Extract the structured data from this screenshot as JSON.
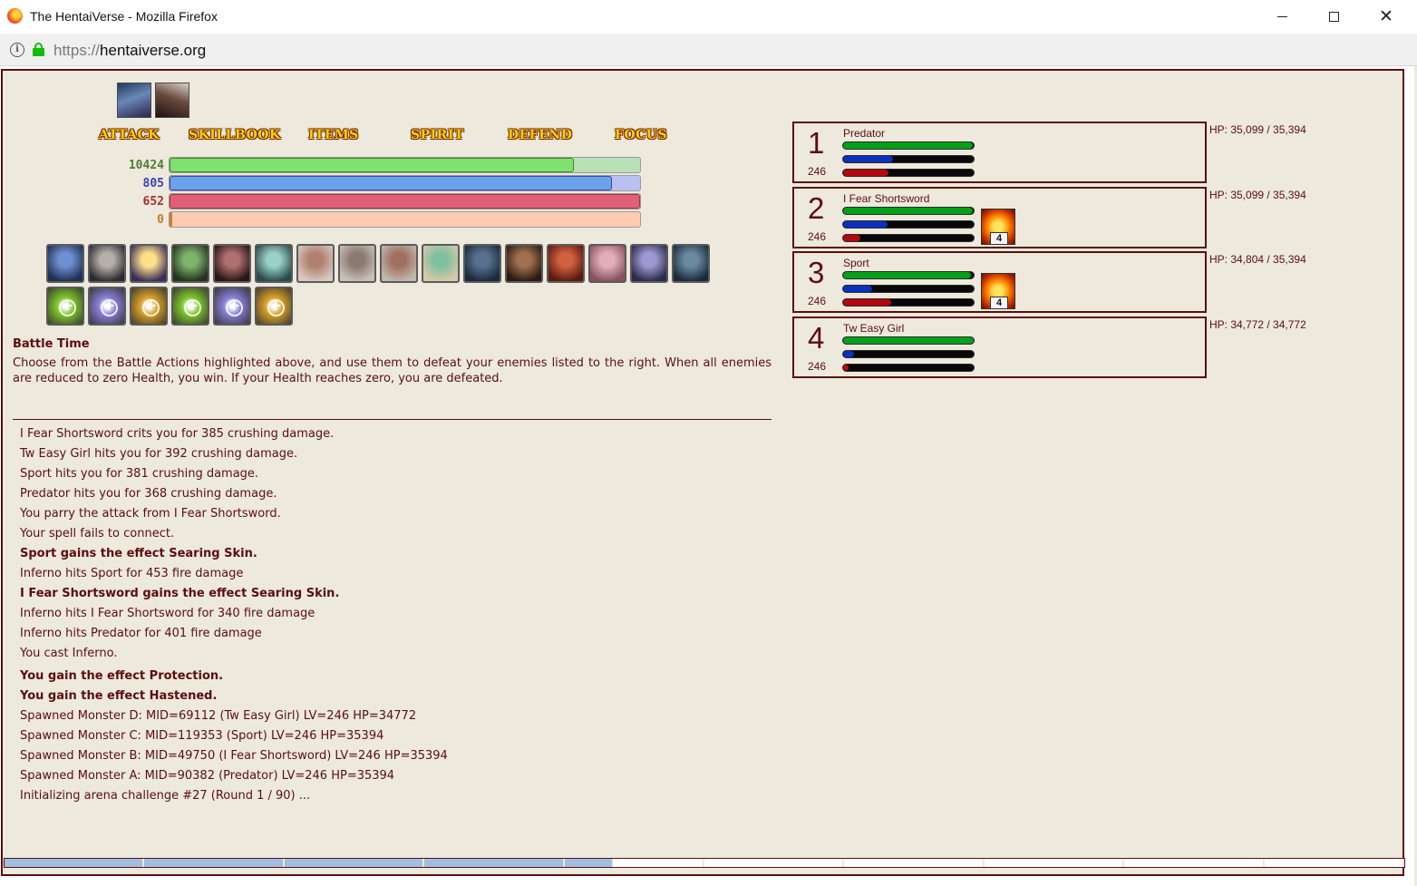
{
  "window": {
    "title": "The HentaiVerse - Mozilla Firefox",
    "url_scheme": "https://",
    "url_host": "hentaiverse.org",
    "controls": {
      "minimize": "minimize-icon",
      "maximize": "maximize-icon",
      "close": "close-icon"
    },
    "close_glyph": "✕"
  },
  "player": {
    "effects": [
      "protection-effect-icon",
      "hastened-effect-icon"
    ]
  },
  "commands": [
    {
      "label": "ATTACK"
    },
    {
      "label": "SKILLBOOK"
    },
    {
      "label": "ITEMS"
    },
    {
      "label": "SPIRIT"
    },
    {
      "label": "DEFEND"
    },
    {
      "label": "FOCUS"
    }
  ],
  "vitals": [
    {
      "name": "health",
      "value": "10424",
      "fill": 0.86,
      "color": "#4f7f2b",
      "bar": "#7fe16f",
      "track": "#b8dfb5"
    },
    {
      "name": "magic",
      "value": "805",
      "fill": 0.94,
      "color": "#3b3fb6",
      "bar": "#6ba3ea",
      "track": "#b9c1f3"
    },
    {
      "name": "spirit",
      "value": "652",
      "fill": 1.0,
      "color": "#a73030",
      "bar": "#e0607a",
      "track": "#f3b8c0"
    },
    {
      "name": "overcharge",
      "value": "0",
      "fill": 0.005,
      "color": "#c97a2a",
      "bar": "#e07b29",
      "track": "#ffcbb3"
    }
  ],
  "skills": [
    {
      "name": "skill-1"
    },
    {
      "name": "skill-2"
    },
    {
      "name": "skill-3"
    },
    {
      "name": "skill-4"
    },
    {
      "name": "skill-5"
    },
    {
      "name": "skill-6"
    },
    {
      "name": "skill-7"
    },
    {
      "name": "skill-8"
    },
    {
      "name": "skill-9"
    },
    {
      "name": "skill-10"
    },
    {
      "name": "skill-11"
    },
    {
      "name": "skill-12"
    },
    {
      "name": "skill-13"
    },
    {
      "name": "skill-14"
    },
    {
      "name": "skill-15"
    },
    {
      "name": "skill-16"
    }
  ],
  "spells": [
    {
      "color": "#7fc62e"
    },
    {
      "color": "#8a7fd6"
    },
    {
      "color": "#d8a12a"
    },
    {
      "color": "#7fc62e"
    },
    {
      "color": "#8a7fd6"
    },
    {
      "color": "#d8a12a"
    }
  ],
  "info": {
    "title": "Battle Time",
    "text": "Choose from the Battle Actions highlighted above, and use them to defeat your enemies listed to the right. When all enemies are reduced to zero Health, you win. If your Health reaches zero, you are defeated."
  },
  "log": [
    {
      "text": "I Fear Shortsword crits you for 385 crushing damage.",
      "bold": false
    },
    {
      "text": "Tw Easy Girl hits you for 392 crushing damage.",
      "bold": false
    },
    {
      "text": "Sport hits you for 381 crushing damage.",
      "bold": false
    },
    {
      "text": "Predator hits you for 368 crushing damage.",
      "bold": false
    },
    {
      "text": "You parry the attack from I Fear Shortsword.",
      "bold": false
    },
    {
      "text": "Your spell fails to connect.",
      "bold": false
    },
    {
      "text": "Sport gains the effect Searing Skin.",
      "bold": true
    },
    {
      "text": "Inferno hits Sport for 453 fire damage",
      "bold": false
    },
    {
      "text": "I Fear Shortsword gains the effect Searing Skin.",
      "bold": true
    },
    {
      "text": "Inferno hits I Fear Shortsword for 340 fire damage",
      "bold": false
    },
    {
      "text": "Inferno hits Predator for 401 fire damage",
      "bold": false
    },
    {
      "text": "You cast Inferno.",
      "bold": false
    },
    {
      "text": "You gain the effect Protection.",
      "bold": true
    },
    {
      "text": "You gain the effect Hastened.",
      "bold": true
    },
    {
      "text": "Spawned Monster D: MID=69112 (Tw Easy Girl) LV=246 HP=34772",
      "bold": false
    },
    {
      "text": "Spawned Monster C: MID=119353 (Sport) LV=246 HP=35394",
      "bold": false
    },
    {
      "text": "Spawned Monster B: MID=49750 (I Fear Shortsword) LV=246 HP=35394",
      "bold": false
    },
    {
      "text": "Spawned Monster A: MID=90382 (Predator) LV=246 HP=35394",
      "bold": false
    },
    {
      "text": "Initializing arena challenge #27 (Round 1 / 90) ...",
      "bold": false
    }
  ],
  "monsters": [
    {
      "num": "1",
      "lv": "246",
      "name": "Predator",
      "hp": 0.99,
      "mp": 0.38,
      "sp": 0.35,
      "hp_text": "HP: 35,099 / 35,394",
      "effect": null
    },
    {
      "num": "2",
      "lv": "246",
      "name": "I Fear Shortsword",
      "hp": 0.99,
      "mp": 0.34,
      "sp": 0.13,
      "hp_text": "HP: 35,099 / 35,394",
      "effect": {
        "icon": "searing-skin-effect-icon",
        "count": "4"
      }
    },
    {
      "num": "3",
      "lv": "246",
      "name": "Sport",
      "hp": 0.98,
      "mp": 0.22,
      "sp": 0.37,
      "hp_text": "HP: 34,804 / 35,394",
      "effect": {
        "icon": "searing-skin-effect-icon",
        "count": "4"
      }
    },
    {
      "num": "4",
      "lv": "246",
      "name": "Tw Easy Girl",
      "hp": 1.0,
      "mp": 0.08,
      "sp": 0.04,
      "hp_text": "HP: 34,772 / 34,772",
      "effect": null
    }
  ],
  "colors": {
    "accent": "#5c0d11",
    "background": "#ede9dd",
    "hp": "#05a01a",
    "mp": "#0b2fbf",
    "sp": "#b4080f"
  },
  "turn_bar": {
    "segments": 10,
    "filled": 0.434,
    "fill_color": "#9fbfe0"
  }
}
